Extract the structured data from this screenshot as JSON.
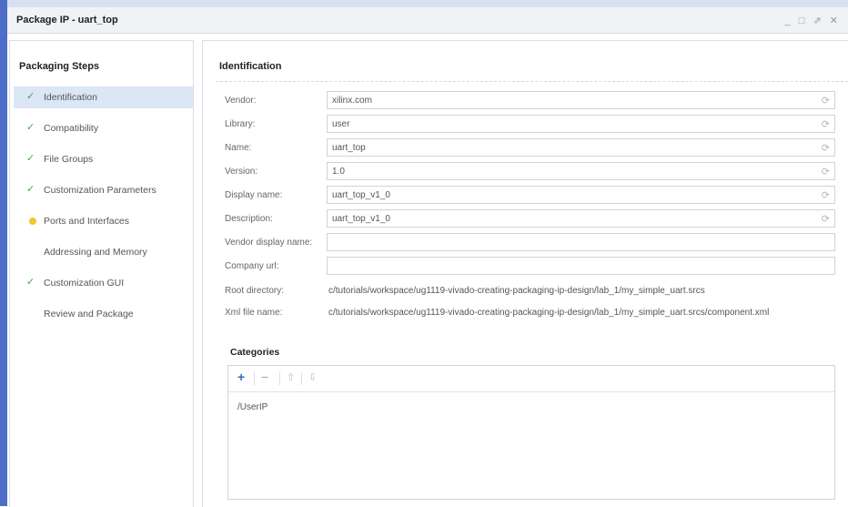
{
  "window": {
    "title": "Package IP - uart_top",
    "controls": "_ □ ⇗ ✕"
  },
  "left_panel": {
    "title": "Packaging Steps",
    "steps": [
      {
        "label": "Identification",
        "status": "check",
        "active": true
      },
      {
        "label": "Compatibility",
        "status": "check"
      },
      {
        "label": "File Groups",
        "status": "check"
      },
      {
        "label": "Customization Parameters",
        "status": "check"
      },
      {
        "label": "Ports and Interfaces",
        "status": "warning"
      },
      {
        "label": "Addressing and Memory",
        "status": "none"
      },
      {
        "label": "Customization GUI",
        "status": "check"
      },
      {
        "label": "Review and Package",
        "status": "none"
      }
    ]
  },
  "main": {
    "section_title": "Identification",
    "fields": {
      "vendor": {
        "label": "Vendor:",
        "value": "xilinx.com"
      },
      "library": {
        "label": "Library:",
        "value": "user"
      },
      "name": {
        "label": "Name:",
        "value": "uart_top"
      },
      "version": {
        "label": "Version:",
        "value": "1.0"
      },
      "display_name": {
        "label": "Display name:",
        "value": "uart_top_v1_0"
      },
      "description": {
        "label": "Description:",
        "value": "uart_top_v1_0"
      },
      "vendor_display_name": {
        "label": "Vendor display name:",
        "value": ""
      },
      "company_url": {
        "label": "Company url:",
        "value": ""
      },
      "root_directory": {
        "label": "Root directory:",
        "value": "c/tutorials/workspace/ug1119-vivado-creating-packaging-ip-design/lab_1/my_simple_uart.srcs"
      },
      "xml_file_name": {
        "label": "Xml file name:",
        "value": "c/tutorials/workspace/ug1119-vivado-creating-packaging-ip-design/lab_1/my_simple_uart.srcs/component.xml"
      }
    },
    "categories": {
      "title": "Categories",
      "toolbar": {
        "add": "+",
        "remove": "−",
        "up": "⇧",
        "down": "⇩"
      },
      "items": [
        "/UserIP"
      ]
    }
  },
  "icons": {
    "check": "✓",
    "refresh": "⟳"
  },
  "colors": {
    "accent_blue": "#4c6ec8",
    "selection": "#dbe6f7",
    "check_green": "#49a544",
    "warning_yellow": "#f3c52b"
  }
}
